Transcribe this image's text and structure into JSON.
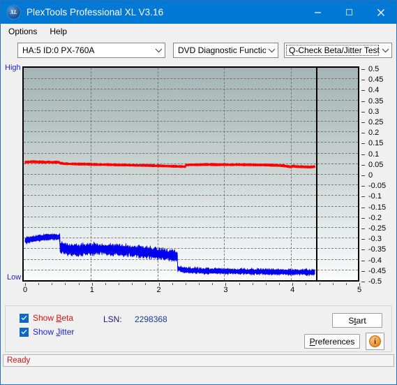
{
  "window": {
    "title": "PlexTools Professional XL V3.16",
    "app_icon": "XL",
    "icon_name": "plextools-xl-icon",
    "minimize_label": "Minimize",
    "maximize_label": "Maximize",
    "close_label": "Close",
    "titlebar_color": "#0078d4"
  },
  "menubar": {
    "items": [
      {
        "label": "Options",
        "name": "menu-options"
      },
      {
        "label": "Help",
        "name": "menu-help"
      }
    ]
  },
  "toolbar": {
    "drive_combo": {
      "value": "HA:5 ID:0  PX-760A",
      "name": "drive-select"
    },
    "function_combo": {
      "value": "DVD Diagnostic Functions",
      "name": "function-select"
    },
    "test_combo": {
      "value": "Q-Check Beta/Jitter Test",
      "name": "test-select",
      "focused": true
    }
  },
  "chart_data": {
    "type": "line",
    "title": "",
    "xlabel": "",
    "ylabel": "",
    "xlim": [
      0,
      5
    ],
    "ylim": [
      -0.5,
      0.5
    ],
    "xticks": [
      0,
      1,
      2,
      3,
      4,
      5
    ],
    "yticks": [
      0.5,
      0.45,
      0.4,
      0.35,
      0.3,
      0.25,
      0.2,
      0.15,
      0.1,
      0.05,
      0,
      -0.05,
      -0.1,
      -0.15,
      -0.2,
      -0.25,
      -0.3,
      -0.35,
      -0.4,
      -0.45,
      -0.5
    ],
    "axis_top_label": "High",
    "axis_bottom_label": "Low",
    "grid": true,
    "legend": "external",
    "end_of_data_x": 4.37,
    "series": [
      {
        "name": "Beta",
        "color": "#ff0000",
        "x": [
          0.0,
          0.05,
          0.1,
          0.15,
          0.2,
          0.25,
          0.3,
          0.35,
          0.4,
          0.45,
          0.5,
          0.55,
          0.6,
          0.7,
          0.8,
          0.9,
          1.0,
          1.1,
          1.2,
          1.3,
          1.4,
          1.5,
          1.6,
          1.7,
          1.8,
          1.9,
          2.0,
          2.1,
          2.2,
          2.3,
          2.4,
          2.45,
          2.5,
          2.6,
          2.7,
          2.8,
          2.9,
          3.0,
          3.1,
          3.2,
          3.3,
          3.4,
          3.5,
          3.6,
          3.7,
          3.8,
          3.9,
          4.0,
          4.05,
          4.1,
          4.2,
          4.3,
          4.37
        ],
        "values": [
          0.055,
          0.056,
          0.057,
          0.057,
          0.056,
          0.056,
          0.055,
          0.056,
          0.055,
          0.055,
          0.055,
          0.05,
          0.048,
          0.047,
          0.046,
          0.046,
          0.045,
          0.044,
          0.044,
          0.043,
          0.042,
          0.042,
          0.041,
          0.04,
          0.04,
          0.039,
          0.038,
          0.037,
          0.036,
          0.035,
          0.034,
          0.042,
          0.043,
          0.043,
          0.044,
          0.044,
          0.043,
          0.044,
          0.043,
          0.044,
          0.043,
          0.043,
          0.042,
          0.042,
          0.041,
          0.04,
          0.038,
          0.033,
          0.036,
          0.034,
          0.033,
          0.032,
          0.034
        ]
      },
      {
        "name": "Jitter",
        "color": "#0000ee",
        "x": [
          0.0,
          0.05,
          0.1,
          0.15,
          0.2,
          0.25,
          0.3,
          0.35,
          0.4,
          0.45,
          0.5,
          0.55,
          0.6,
          0.7,
          0.8,
          0.9,
          1.0,
          1.1,
          1.2,
          1.3,
          1.4,
          1.5,
          1.6,
          1.7,
          1.8,
          1.9,
          2.0,
          2.1,
          2.2,
          2.28,
          2.32,
          2.4,
          2.5,
          2.6,
          2.7,
          2.8,
          2.9,
          3.0,
          3.1,
          3.2,
          3.3,
          3.4,
          3.5,
          3.6,
          3.7,
          3.8,
          3.9,
          4.0,
          4.1,
          4.2,
          4.3,
          4.37
        ],
        "values": [
          -0.318,
          -0.314,
          -0.31,
          -0.308,
          -0.306,
          -0.304,
          -0.302,
          -0.301,
          -0.3,
          -0.3,
          -0.301,
          -0.352,
          -0.357,
          -0.362,
          -0.364,
          -0.36,
          -0.358,
          -0.357,
          -0.359,
          -0.362,
          -0.363,
          -0.365,
          -0.366,
          -0.368,
          -0.372,
          -0.376,
          -0.38,
          -0.384,
          -0.388,
          -0.392,
          -0.452,
          -0.458,
          -0.46,
          -0.461,
          -0.462,
          -0.463,
          -0.463,
          -0.464,
          -0.464,
          -0.465,
          -0.465,
          -0.466,
          -0.466,
          -0.466,
          -0.467,
          -0.467,
          -0.467,
          -0.468,
          -0.468,
          -0.468,
          -0.469,
          -0.469
        ],
        "noise_band": 0.022,
        "note": "dense noisy band; amplitude varies by segment"
      }
    ]
  },
  "controls": {
    "show_beta": {
      "label_prefix": "Show ",
      "label_key": "B",
      "label_suffix": "eta",
      "checked": true,
      "color": "#e01010"
    },
    "show_jitter": {
      "label_prefix": "Show ",
      "label_key": "J",
      "label_suffix": "itter",
      "checked": true,
      "color": "#2020e0"
    },
    "lsn_label": "LSN:",
    "lsn_value": "2298368",
    "start_button": {
      "prefix": "S",
      "key": "t",
      "suffix": "art",
      "full": "Start"
    },
    "preferences_button": {
      "prefix": "",
      "key": "P",
      "suffix": "references",
      "full": "Preferences"
    },
    "info_button": {
      "glyph": "i",
      "name": "info-button"
    }
  },
  "statusbar": {
    "text": "Ready",
    "color": "#dd1111"
  }
}
